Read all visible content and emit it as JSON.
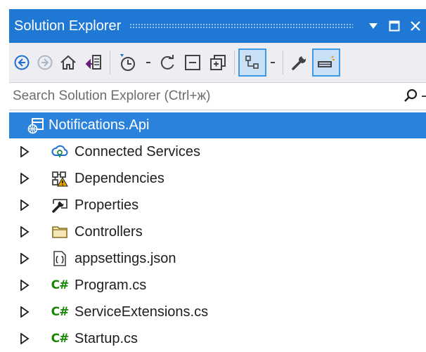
{
  "window": {
    "title": "Solution Explorer",
    "controls": [
      "dropdown-arrow",
      "maximize",
      "close"
    ]
  },
  "toolbar": {
    "buttons": [
      "back",
      "forward",
      "home",
      "switch-views",
      "pending-changes-filter",
      "sync",
      "collapse-all",
      "show-all-files",
      "preview-selected",
      "properties",
      "view-toggle"
    ]
  },
  "search": {
    "placeholder": "Search Solution Explorer (Ctrl+ж)"
  },
  "tree": {
    "root": {
      "label": "Notifications.Api",
      "icon": "web-project-icon",
      "selected": true
    },
    "items": [
      {
        "label": "Connected Services",
        "icon": "connected-services-icon"
      },
      {
        "label": "Dependencies",
        "icon": "dependencies-warning-icon"
      },
      {
        "label": "Properties",
        "icon": "properties-icon"
      },
      {
        "label": "Controllers",
        "icon": "folder-icon"
      },
      {
        "label": "appsettings.json",
        "icon": "json-file-icon"
      },
      {
        "label": "Program.cs",
        "icon": "csharp-icon",
        "prefix": "C#"
      },
      {
        "label": "ServiceExtensions.cs",
        "icon": "csharp-icon",
        "prefix": "C#"
      },
      {
        "label": "Startup.cs",
        "icon": "csharp-icon",
        "prefix": "C#"
      }
    ]
  },
  "colors": {
    "title_bar": "#1e78d4",
    "selection": "#2b82dc",
    "toolbar": "#eeeef2",
    "csharp": "#178600"
  }
}
